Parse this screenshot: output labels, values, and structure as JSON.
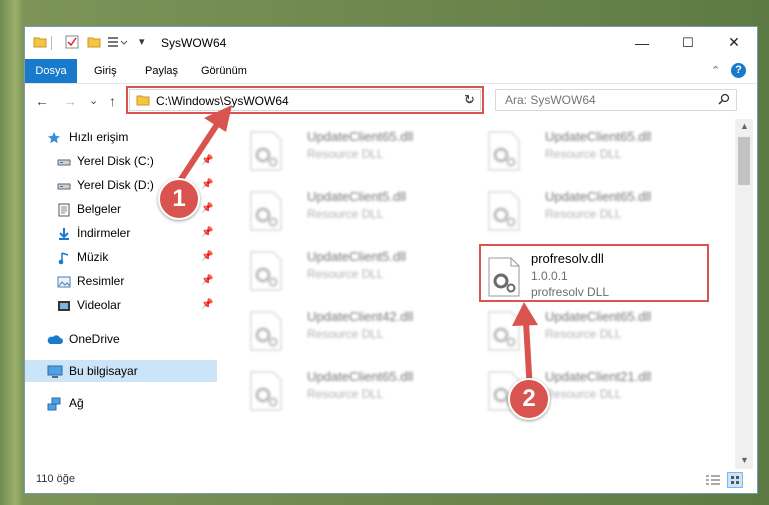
{
  "window": {
    "title": "SysWOW64",
    "controls": {
      "minimize": "—",
      "maximize": "☐",
      "close": "✕"
    }
  },
  "ribbon": {
    "tabs": [
      "Dosya",
      "Giriş",
      "Paylaş",
      "Görünüm"
    ],
    "collapse_icon": "chevron-up-icon",
    "help": "?"
  },
  "nav": {
    "back": "←",
    "forward": "→",
    "recent": "⌄",
    "up": "↑",
    "address": "C:\\Windows\\SysWOW64",
    "refresh": "↻",
    "search_placeholder": "Ara: SysWOW64"
  },
  "sidebar": {
    "items": [
      {
        "label": "Hızlı erişim",
        "icon": "star-icon"
      },
      {
        "label": "Yerel Disk (C:)",
        "icon": "drive-icon"
      },
      {
        "label": "Yerel Disk (D:)",
        "icon": "drive-icon"
      },
      {
        "label": "Belgeler",
        "icon": "documents-icon"
      },
      {
        "label": "İndirmeler",
        "icon": "download-icon"
      },
      {
        "label": "Müzik",
        "icon": "music-icon"
      },
      {
        "label": "Resimler",
        "icon": "pictures-icon"
      },
      {
        "label": "Videolar",
        "icon": "videos-icon"
      },
      {
        "label": "OneDrive",
        "icon": "cloud-icon"
      },
      {
        "label": "Bu bilgisayar",
        "icon": "computer-icon"
      },
      {
        "label": "Ağ",
        "icon": "network-icon"
      }
    ]
  },
  "files": {
    "items": [
      {
        "name": "UpdateClient65.dll",
        "desc": "Resource DLL",
        "sub": ""
      },
      {
        "name": "UpdateClient65.dll",
        "desc": "Resource DLL",
        "sub": ""
      },
      {
        "name": "UpdateClient5.dll",
        "desc": "Resource DLL",
        "sub": ""
      },
      {
        "name": "UpdateClient65.dll",
        "desc": "Resource DLL",
        "sub": ""
      },
      {
        "name": "UpdateClient5.dll",
        "desc": "Resource DLL",
        "sub": ""
      },
      {
        "name": "profresolv.dll",
        "desc": "1.0.0.1",
        "sub": "profresolv DLL"
      },
      {
        "name": "UpdateClient42.dll",
        "desc": "Resource DLL",
        "sub": ""
      },
      {
        "name": "UpdateClient65.dll",
        "desc": "Resource DLL",
        "sub": ""
      },
      {
        "name": "UpdateClient65.dll",
        "desc": "Resource DLL",
        "sub": ""
      },
      {
        "name": "UpdateClient21.dll",
        "desc": "Resource DLL",
        "sub": ""
      }
    ]
  },
  "status": {
    "count": "110 öğe"
  },
  "annotations": {
    "step1": "1",
    "step2": "2",
    "color": "#d9534f"
  }
}
